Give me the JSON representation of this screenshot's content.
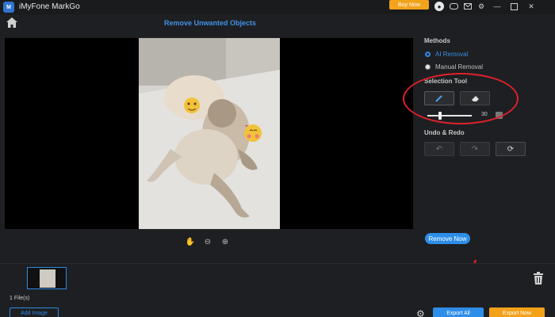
{
  "app": {
    "title": "iMyFone MarkGo",
    "logo_text": "M"
  },
  "titlebar": {
    "buy_label": "Buy Now",
    "icons": [
      "avatar-icon",
      "gamepad-icon",
      "mail-icon",
      "settings-icon",
      "minimize-icon",
      "maximize-icon",
      "close-icon"
    ]
  },
  "header": {
    "page_title": "Remove Unwanted Objects"
  },
  "right_panel": {
    "methods_heading": "Methods",
    "method_ai": "AI Removal",
    "method_manual": "Manual Removal",
    "selection_heading": "Selection Tool",
    "brush_size": "30",
    "undo_redo_heading": "Undo & Redo",
    "remove_now_label": "Remove Now"
  },
  "bottom": {
    "file_count": "1 File(s)",
    "add_image_label": "Add Image",
    "export_all_label": "Export All",
    "export_now_label": "Export Now"
  },
  "colors": {
    "accent": "#2d8de8",
    "buy": "#f2a31b",
    "annotation": "#e0212b"
  }
}
